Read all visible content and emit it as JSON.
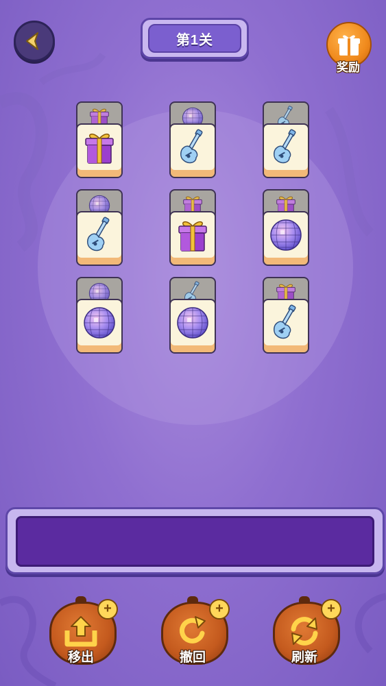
{
  "header": {
    "level_title": "第1关",
    "reward_label": "奖励"
  },
  "board": {
    "tiles": [
      {
        "front": "gift-box",
        "behind": "gift-box"
      },
      {
        "front": "guitar",
        "behind": "disco-ball"
      },
      {
        "front": "guitar",
        "behind": "guitar"
      },
      {
        "front": "guitar",
        "behind": "disco-ball"
      },
      {
        "front": "gift-box",
        "behind": "gift-box"
      },
      {
        "front": "disco-ball",
        "behind": "gift-box"
      },
      {
        "front": "disco-ball",
        "behind": "disco-ball"
      },
      {
        "front": "disco-ball",
        "behind": "guitar"
      },
      {
        "front": "guitar",
        "behind": "gift-box"
      }
    ]
  },
  "tools": [
    {
      "label": "移出",
      "icon": "move-out-icon"
    },
    {
      "label": "撤回",
      "icon": "undo-icon"
    },
    {
      "label": "刷新",
      "icon": "refresh-icon"
    }
  ],
  "colors": {
    "background": "#8f6fd0",
    "slot_bar": "#5b2ba0",
    "tile_face": "#fbf4dc",
    "tile_back": "#a8a5a0",
    "pumpkin": "#c45a1e"
  }
}
